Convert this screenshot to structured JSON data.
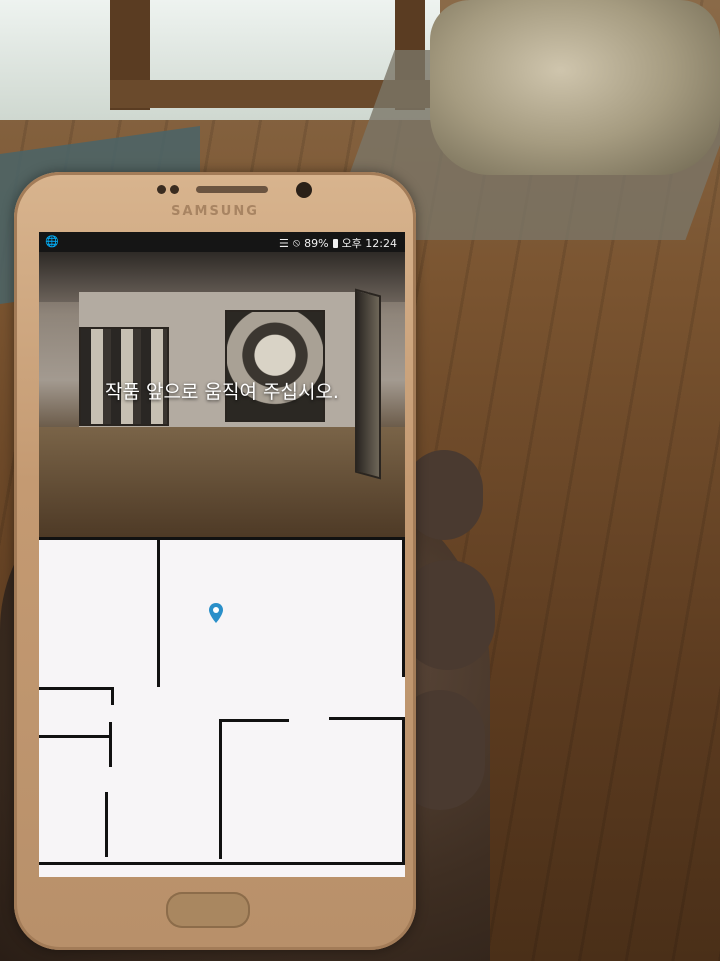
{
  "status_bar": {
    "left_icon": "app-notification-icon",
    "wifi_icon": "wifi-icon",
    "dnd_icon": "do-not-disturb-icon",
    "battery_percent": "89%",
    "time": "오후 12:24"
  },
  "device": {
    "brand": "SAMSUNG"
  },
  "gallery_view": {
    "instruction": "작품 앞으로 움직여 주십시오."
  },
  "floor_map": {
    "pin_icon": "location-pin-icon",
    "pin_color": "#2a8fc9"
  },
  "colors": {
    "map_background": "#f7f5f7",
    "wall": "#111111",
    "status_bar": "#151515"
  }
}
